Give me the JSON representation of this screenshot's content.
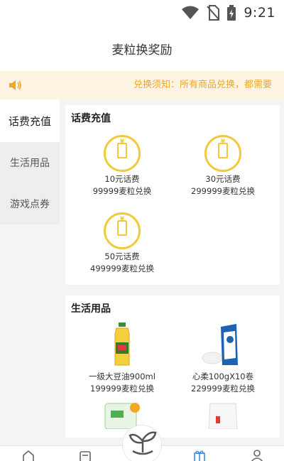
{
  "status": {
    "time": "9:21"
  },
  "header": {
    "title": "麦粒换奖励"
  },
  "notice": {
    "text": "兑换须知：所有商品兑换，都需要"
  },
  "sidebar": {
    "items": [
      {
        "label": "话费充值"
      },
      {
        "label": "生活用品"
      },
      {
        "label": "游戏点券"
      }
    ]
  },
  "sections": [
    {
      "title": "话费充值",
      "items": [
        {
          "name": "10元话费",
          "price": "99999麦粒兑换",
          "icon": "phone-coin-icon"
        },
        {
          "name": "30元话费",
          "price": "299999麦粒兑换",
          "icon": "phone-coin-icon"
        },
        {
          "name": "50元话费",
          "price": "499999麦粒兑换",
          "icon": "phone-coin-icon"
        }
      ]
    },
    {
      "title": "生活用品",
      "items": [
        {
          "name": "一级大豆油900ml",
          "price": "199999麦粒兑换",
          "icon": "oil-bottle-image"
        },
        {
          "name": "心柔100gX10卷",
          "price": "229999麦粒兑换",
          "icon": "tissue-pack-image"
        },
        {
          "name": "",
          "price": "",
          "icon": "rice-bag-image"
        },
        {
          "name": "",
          "price": "",
          "icon": "flour-bag-image"
        }
      ]
    }
  ],
  "bottom_nav": {
    "items": [
      "home-icon",
      "ticket-icon",
      "sprout-icon",
      "gift-icon",
      "user-icon"
    ],
    "active_color": "#3d8be8"
  },
  "colors": {
    "accent": "#f1a52a",
    "notice_bg": "#fff4e2",
    "coin": "#f2c93a"
  }
}
